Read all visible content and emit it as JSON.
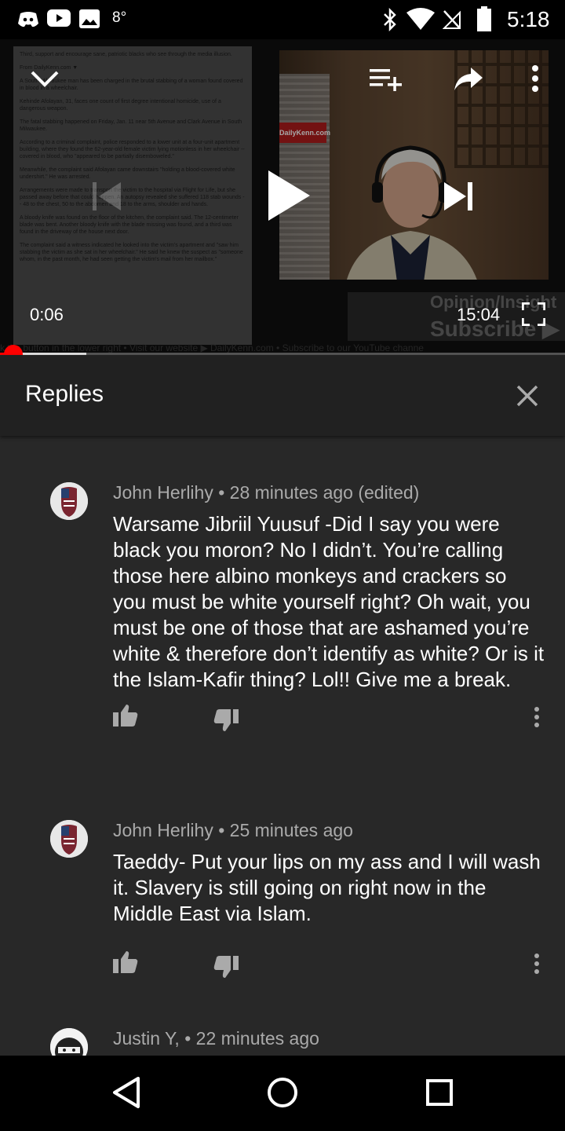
{
  "status_bar": {
    "temperature": "8°",
    "time": "5:18",
    "icons": [
      "discord-icon",
      "youtube-icon",
      "gallery-icon",
      "bluetooth-icon",
      "wifi-icon",
      "no-sim-icon",
      "battery-icon"
    ]
  },
  "video": {
    "current_time": "0:06",
    "duration": "15:04",
    "progress_fraction": 0.0066,
    "buffered_fraction": 0.153,
    "article_paragraphs": [
      "Third, support and encourage sane, patriotic blacks who see through the media illusion.",
      "From DailyKenn.com ▼",
      "A South Milwaukee man has been charged in the brutal stabbing of a woman found covered in blood in a wheelchair.",
      "Kehinde Afolayan, 31, faces one count of first degree intentional homicide, use of a dangerous weapon.",
      "The fatal stabbing happened on Friday, Jan. 11 near 5th Avenue and Clark Avenue in South Milwaukee.",
      "According to a criminal complaint, police responded to a lower unit at a four-unit apartment building, where they found the 62-year-old female victim lying motionless in her wheelchair -- covered in blood, who \"appeared to be partially disemboweled.\"",
      "Meanwhile, the complaint said Afolayan came downstairs \"holding a blood-covered white undershirt.\" He was arrested.",
      "Arrangements were made to transport the victim to the hospital via Flight for Life, but she passed away before that could happen. An autopsy revealed she suffered 118 stab wounds -- 48 to the chest, 50 to the abdomen and 18 to the arms, shoulder and hands.",
      "A bloody knife was found on the floor of the kitchen, the complaint said. The 12-centimeter blade was bent. Another bloody knife with the blade missing was found, and a third was found in the driveway of the house next door.",
      "The complaint said a witness indicated he looked into the victim's apartment and \"saw him stabbing the victim as she sat in her wheelchair.\" He said he knew the suspect as \"someone whom, in the past month, he had seen getting the victim's mail from her mailbox.\""
    ],
    "sign_text": "DailyKenn.com",
    "promo_line1": "Opinion/Insight",
    "promo_line2": "Subscribe ▶",
    "marquee": "k the button in the lower right   •   Visit our website ▶ DailyKenn.com   •   Subscribe to our YouTube channe"
  },
  "panel": {
    "title": "Replies",
    "comments": [
      {
        "author": "John Herlihy",
        "meta": "John Herlihy • 28 minutes ago (edited)",
        "text": "Warsame Jibriil Yuusuf -Did I say you were black you moron?  No I didn’t.  You’re calling those here albino monkeys and crackers so you must be white yourself right?  Oh wait, you must be one of those that are ashamed you’re white & therefore don’t identify as white?  Or is it the Islam-Kafir thing?  Lol!! Give me a break."
      },
      {
        "author": "John Herlihy",
        "meta": "John Herlihy • 25 minutes ago",
        "text": "Taeddy- Put your lips on my ass and I will wash it. Slavery is still going on right now in the Middle East via Islam."
      },
      {
        "author": "Justin Y,",
        "meta": "Justin Y, • 22 minutes ago",
        "text": ""
      }
    ]
  },
  "colors": {
    "panel_bg": "#282828",
    "header_bg": "#212121",
    "meta_text": "#aaaaaa",
    "progress_red": "#ff0000"
  }
}
